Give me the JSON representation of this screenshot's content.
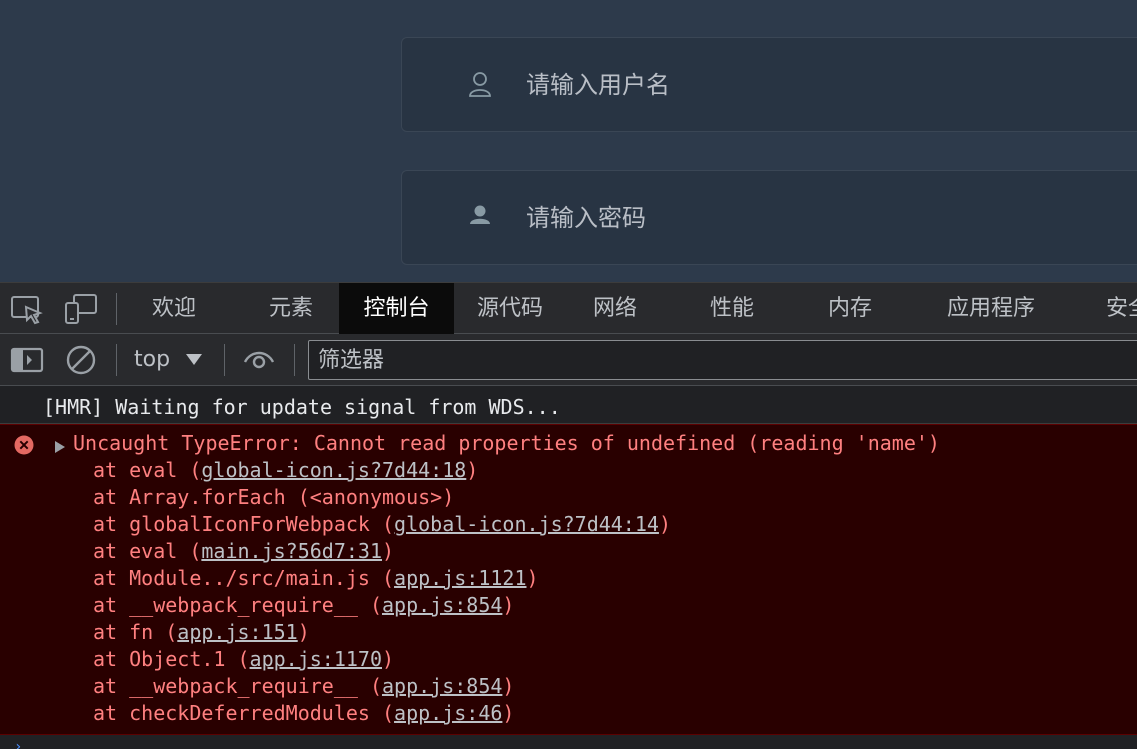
{
  "login": {
    "username_placeholder": "请输入用户名",
    "password_placeholder": "请输入密码"
  },
  "devtools": {
    "tabs": [
      "欢迎",
      "元素",
      "控制台",
      "源代码",
      "网络",
      "性能",
      "内存",
      "应用程序",
      "安全"
    ],
    "active_tab": "控制台",
    "toolbar": {
      "context": "top",
      "filter_placeholder": "筛选器"
    },
    "console": {
      "log_message": "[HMR] Waiting for update signal from WDS...",
      "error": {
        "message": "Uncaught TypeError: Cannot read properties of undefined (reading 'name')",
        "frames": [
          {
            "fn": "at eval (",
            "link": "global-icon.js?7d44:18",
            "end": ")"
          },
          {
            "fn": "at Array.forEach (<anonymous>)",
            "link": "",
            "end": ""
          },
          {
            "fn": "at globalIconForWebpack (",
            "link": "global-icon.js?7d44:14",
            "end": ")"
          },
          {
            "fn": "at eval (",
            "link": "main.js?56d7:31",
            "end": ")"
          },
          {
            "fn": "at Module../src/main.js (",
            "link": "app.js:1121",
            "end": ")"
          },
          {
            "fn": "at __webpack_require__ (",
            "link": "app.js:854",
            "end": ")"
          },
          {
            "fn": "at fn (",
            "link": "app.js:151",
            "end": ")"
          },
          {
            "fn": "at Object.1 (",
            "link": "app.js:1170",
            "end": ")"
          },
          {
            "fn": "at __webpack_require__ (",
            "link": "app.js:854",
            "end": ")"
          },
          {
            "fn": "at checkDeferredModules (",
            "link": "app.js:46",
            "end": ")"
          }
        ]
      }
    }
  },
  "colors": {
    "page_bg": "#2d3a4b",
    "devtools_bg": "#202124",
    "error_bg": "#290000",
    "error_text": "#ff8080",
    "error_icon": "#e46962"
  },
  "icons": [
    "user-icon",
    "password-user-icon",
    "inspect-element-icon",
    "device-emulation-icon",
    "sidebar-toggle-icon",
    "clear-console-icon",
    "live-expression-eye-icon",
    "error-icon",
    "expand-triangle-icon"
  ]
}
